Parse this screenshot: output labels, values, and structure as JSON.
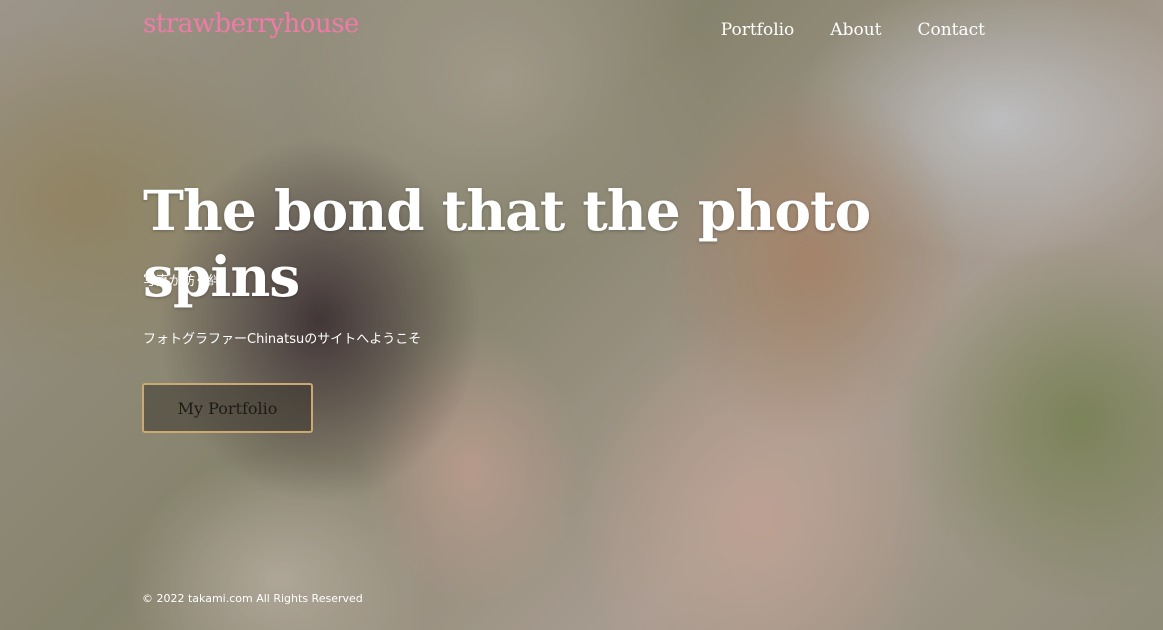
{
  "header": {
    "logo": "strawberryhouse",
    "nav": [
      {
        "label": "Portfolio"
      },
      {
        "label": "About"
      },
      {
        "label": "Contact"
      }
    ]
  },
  "hero": {
    "headline": "The bond that the photo spins",
    "subtitle_jp": "写真が紡ぐ絆",
    "welcome": "フォトグラファーChinatsuのサイトへようこそ",
    "cta_label": "My Portfolio"
  },
  "footer": {
    "copyright": "© 2022 takami.com All Rights Reserved"
  },
  "colors": {
    "logo": "#f07aa8",
    "cta_border": "#c9a974",
    "text": "#ffffff"
  }
}
